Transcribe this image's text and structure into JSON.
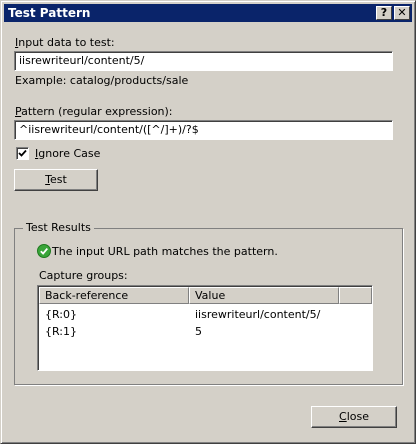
{
  "window": {
    "title": "Test Pattern",
    "help_label": "?",
    "close_label": "✕"
  },
  "input": {
    "label_accel": "I",
    "label_rest": "nput data to test:",
    "value": "iisrewriteurl/content/5/",
    "example": "Example: catalog/products/sale"
  },
  "pattern": {
    "label_accel": "P",
    "label_rest": "attern (regular expression):",
    "value": "^iisrewriteurl/content/([^/]+)/?$"
  },
  "ignore_case": {
    "label_accel": "I",
    "label_rest": "gnore Case",
    "checked": true
  },
  "test_button": {
    "label_accel": "T",
    "label_rest": "est"
  },
  "results": {
    "group_title": "Test Results",
    "status_icon": "check-circle-icon",
    "status_text": "The input URL path matches the pattern.",
    "capture_label": "Capture groups:",
    "columns": [
      "Back-reference",
      "Value"
    ],
    "rows": [
      {
        "ref": "{R:0}",
        "value": "iisrewriteurl/content/5/"
      },
      {
        "ref": "{R:1}",
        "value": "5"
      }
    ]
  },
  "close_button": {
    "label_accel": "C",
    "label_rest": "lose"
  },
  "colors": {
    "titlebar": "#0a246a",
    "face": "#d4d0c8",
    "success": "#3aa53a"
  }
}
